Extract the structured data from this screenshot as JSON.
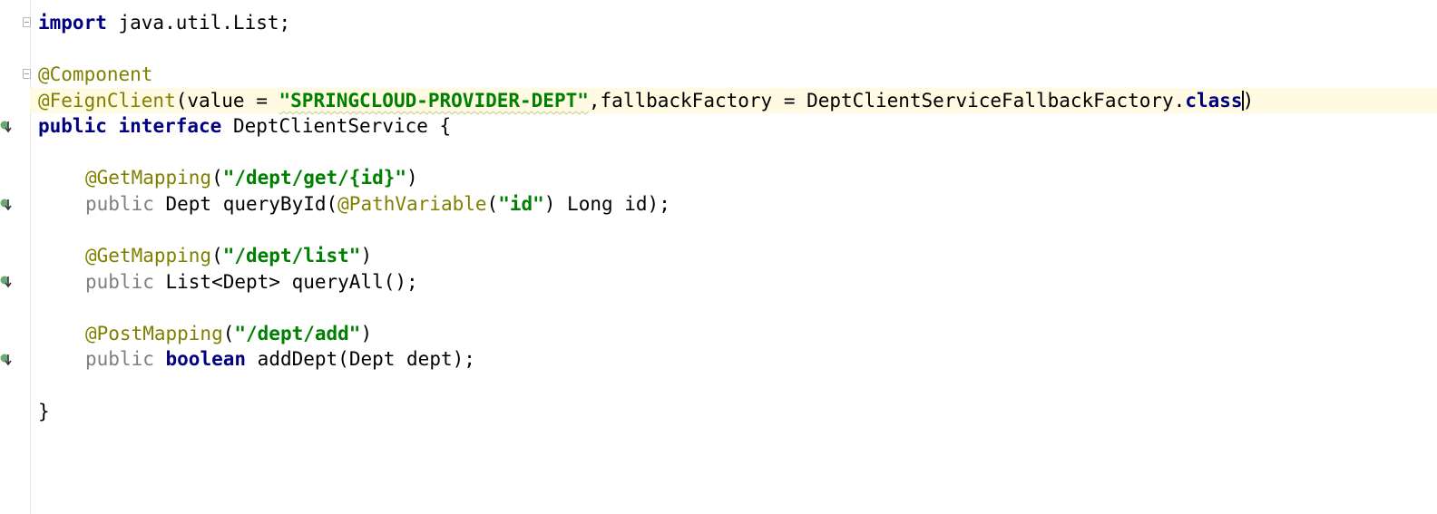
{
  "code": {
    "import_kw": "import",
    "import_path": " java.util.List;",
    "component_ann": "@Component",
    "feign_ann": "@FeignClient",
    "feign_args_open": "(value = ",
    "feign_value_str": "\"SPRINGCLOUD-PROVIDER-DEPT\"",
    "feign_args_mid": ",fallbackFactory = DeptClientServiceFallbackFactory.",
    "class_kw": "class",
    "feign_args_close": ")",
    "public_kw": "public",
    "interface_kw": "interface",
    "interface_name": " DeptClientService {",
    "get_mapping_1": "@GetMapping",
    "get_mapping_1_open": "(",
    "get_mapping_1_path": "\"/dept/get/{id}\"",
    "get_mapping_1_close": ")",
    "method1_public": "public",
    "method1_sig_a": " Dept queryById(",
    "path_variable_ann": "@PathVariable",
    "method1_sig_b": "(",
    "path_variable_str": "\"id\"",
    "method1_sig_c": ") Long id);",
    "get_mapping_2": "@GetMapping",
    "get_mapping_2_open": "(",
    "get_mapping_2_path": "\"/dept/list\"",
    "get_mapping_2_close": ")",
    "method2_public": "public",
    "method2_sig": " List<Dept> queryAll();",
    "post_mapping": "@PostMapping",
    "post_mapping_open": "(",
    "post_mapping_path": "\"/dept/add\"",
    "post_mapping_close": ")",
    "method3_public": "public",
    "method3_boolean": "boolean",
    "method3_sig": " addDept(Dept dept);",
    "closing_brace": "}"
  },
  "colors": {
    "keyword": "#000080",
    "annotation": "#808000",
    "string": "#008000",
    "current_line": "#fffbe3",
    "impl_icon": "#4f9a5a"
  },
  "icons": {
    "fold": "fold-marker-icon",
    "implemented": "implemented-method-icon"
  }
}
